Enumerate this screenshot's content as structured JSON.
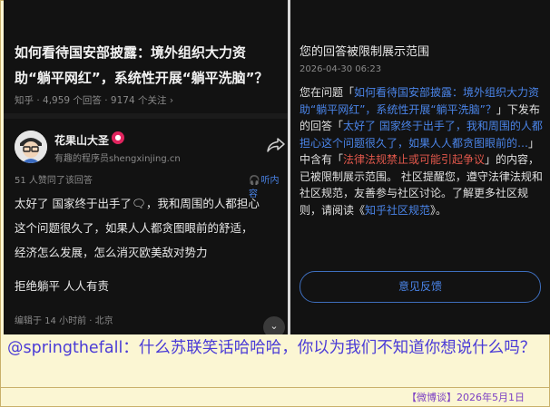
{
  "left_panel": {
    "question_title": "如何看待国安部披露：境外组织大力资助“躺平网红”，系统性开展“躺平洗脑”？",
    "question_meta": "知乎 · 4,959 个回答 · 9174 个关注 ›",
    "author": {
      "name": "花果山大圣",
      "badge": "●",
      "desc": "有趣的程序员shengxinjing.cn"
    },
    "upvotes": "51 人赞同了该回答",
    "listen_label": "听内容",
    "answer_lines": [
      "太好了 国家终于出手了🗨，我和周围的人都担心",
      "这个问题很久了，如果人人都贪图眼前的舒适，",
      "经济怎么发展，怎么消灭欧美敌对势力"
    ],
    "answer_tail": "拒绝躺平 人人有责",
    "edited_meta": "编辑于 14 小时前 · 北京",
    "collapse_label": "⌄"
  },
  "right_panel": {
    "title": "您的回答被限制展示范围",
    "time": "2026-04-30  06:23",
    "body_pre": "您在问题「",
    "body_link_question": "如何看待国安部披露：境外组织大力资助“躺平网红”，系统性开展“躺平洗脑”？",
    "body_mid1": "」下发布的回答「",
    "body_link_answer": "太好了 国家终于出手了，我和周围的人都担心这个问题很久了，如果人人都贪图眼前的…",
    "body_mid2": "」中含有「",
    "body_flag": "法律法规禁止或可能引起争议",
    "body_mid3": "」的内容，已被限制展示范围。 社区提醒您，遵守法律法规和社区规范，友善参与社区讨论。了解更多社区规则，请阅读《",
    "body_link_rules": "知乎社区规范",
    "body_end": "》。",
    "feedback_label": "意见反馈"
  },
  "comment": "@springthefall：什么苏联笑话哈哈哈，你以为我们不知道你想说什么吗？",
  "footer": "【微博谈】2026年5月1日"
}
